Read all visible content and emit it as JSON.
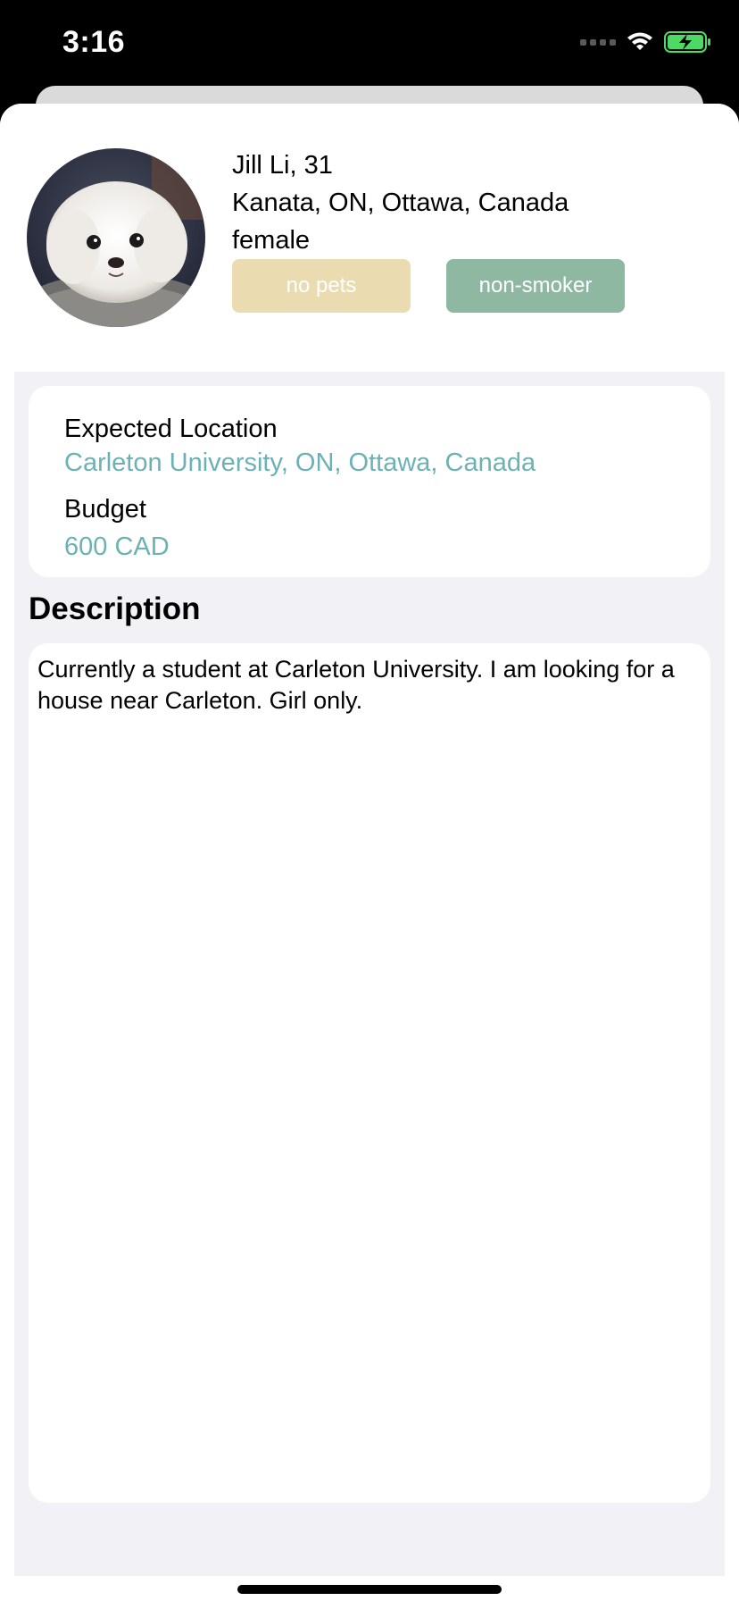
{
  "status_bar": {
    "time": "3:16"
  },
  "profile": {
    "name_age": "Jill Li, 31",
    "location": "Kanata, ON, Ottawa, Canada",
    "gender": "female",
    "tags": [
      "no pets",
      "non-smoker"
    ]
  },
  "details": {
    "expected_location_label": "Expected Location",
    "expected_location_value": "Carleton University, ON, Ottawa, Canada",
    "budget_label": "Budget",
    "budget_value": "600 CAD"
  },
  "description": {
    "title": "Description",
    "text": "Currently a student at Carleton University. I am looking for a house near Carleton. Girl only."
  },
  "colors": {
    "tag_no_pets": "#ebdbb0",
    "tag_non_smoker": "#8fb8a3",
    "accent_value": "#6cb2b4",
    "content_background": "#f1f1f6"
  },
  "icons": [
    "cellular-signal-icon",
    "wifi-icon",
    "battery-charging-icon"
  ]
}
